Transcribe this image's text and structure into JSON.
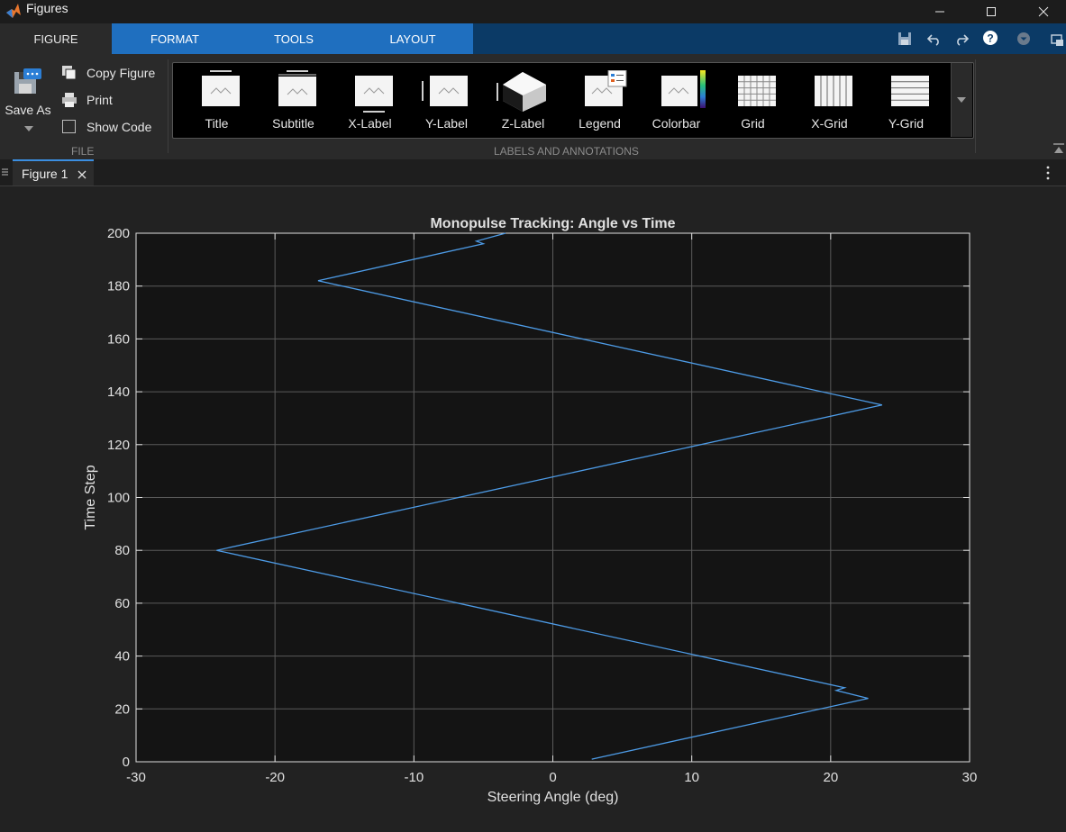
{
  "window": {
    "title": "Figures"
  },
  "ribbon_tabs": [
    {
      "label": "FIGURE",
      "active": true
    },
    {
      "label": "FORMAT",
      "active": false
    },
    {
      "label": "TOOLS",
      "active": false
    },
    {
      "label": "LAYOUT",
      "active": false
    }
  ],
  "file_section": {
    "save_as": "Save As",
    "copy_figure": "Copy Figure",
    "print": "Print",
    "show_code": "Show Code",
    "label": "FILE"
  },
  "labels_section": {
    "label": "LABELS AND ANNOTATIONS",
    "items": [
      "Title",
      "Subtitle",
      "X-Label",
      "Y-Label",
      "Z-Label",
      "Legend",
      "Colorbar",
      "Grid",
      "X-Grid",
      "Y-Grid"
    ]
  },
  "doc_tab": {
    "label": "Figure 1"
  },
  "colors": {
    "line": "#4d9be6",
    "axes_bg": "#141414",
    "grid": "#5a5a5a"
  },
  "chart_data": {
    "type": "line",
    "title": "Monopulse Tracking:  Angle vs Time",
    "xlabel": "Steering Angle (deg)",
    "ylabel": "Time Step",
    "xlim": [
      -30,
      30
    ],
    "ylim": [
      0,
      200
    ],
    "xticks": [
      -30,
      -20,
      -10,
      0,
      10,
      20,
      30
    ],
    "yticks": [
      0,
      20,
      40,
      60,
      80,
      100,
      120,
      140,
      160,
      180,
      200
    ],
    "grid": true,
    "series": [
      {
        "x": [
          2.8,
          22.7,
          20.4,
          21.0,
          -24.2,
          23.7,
          -16.9,
          -5.0,
          -5.5,
          -3.4
        ],
        "y": [
          1,
          24,
          27,
          28,
          80,
          135,
          182,
          196,
          197,
          200
        ]
      }
    ]
  }
}
